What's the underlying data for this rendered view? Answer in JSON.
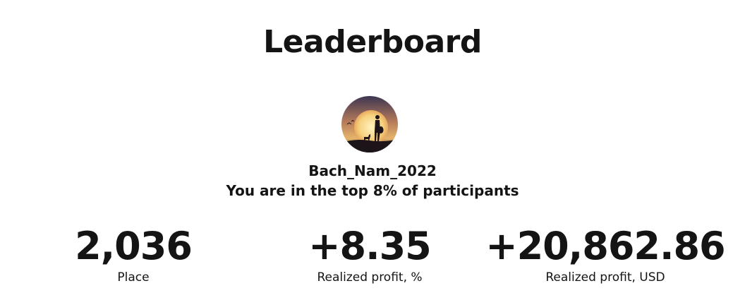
{
  "page": {
    "title": "Leaderboard"
  },
  "user": {
    "name": "Bach_Nam_2022",
    "rank_note": "You are in the top 8% of participants",
    "avatar_icon": "avatar-silhouette-sunset"
  },
  "stats": [
    {
      "value": "2,036",
      "label": "Place"
    },
    {
      "value": "+8.35",
      "label": "Realized profit, %"
    },
    {
      "value": "+20,862.86",
      "label": "Realized profit, USD"
    }
  ],
  "colors": {
    "text": "#141414",
    "background": "#ffffff"
  }
}
